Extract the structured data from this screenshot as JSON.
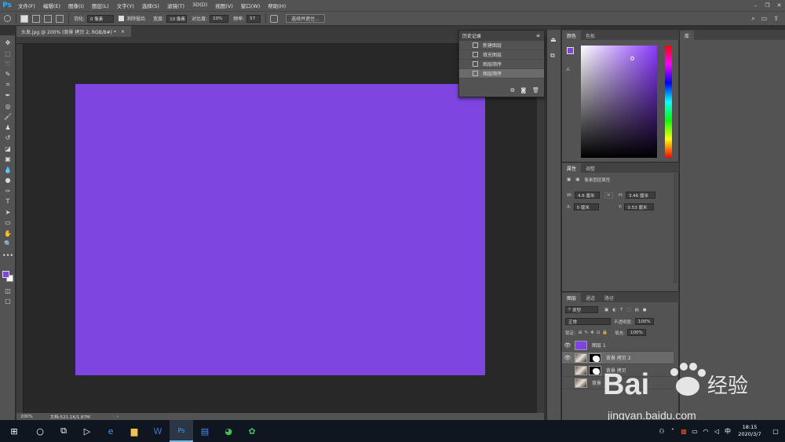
{
  "app": {
    "logo": "Ps"
  },
  "menu": [
    "文件(F)",
    "编辑(E)",
    "图像(I)",
    "图层(L)",
    "文字(Y)",
    "选择(S)",
    "滤镜(T)",
    "3D(D)",
    "视图(V)",
    "窗口(W)",
    "帮助(H)"
  ],
  "window_controls": [
    "–",
    "❐",
    "✕"
  ],
  "options": {
    "feather_label": "羽化:",
    "feather_value": "0 像素",
    "antialias_label": "消除锯齿",
    "width_label": "宽度:",
    "width_value": "10 像素",
    "contrast_label": "对比度:",
    "contrast_value": "10%",
    "frequency_label": "频率:",
    "frequency_value": "57",
    "select_mask_button": "选择并遮住..."
  },
  "document": {
    "tab_title": "头发.jpg @ 200% (背景 拷贝 2, RGB/8#) *",
    "zoom": "200%",
    "doc_info": "文档:521.1K/1.87M",
    "canvas_color": "#7f45e0"
  },
  "history": {
    "title": "历史记录",
    "items": [
      {
        "label": "新建图层",
        "active": false
      },
      {
        "label": "填充图层",
        "active": false
      },
      {
        "label": "图层顺序",
        "active": false
      },
      {
        "label": "图层顺序",
        "active": true
      }
    ]
  },
  "color_panel": {
    "tabs": [
      "颜色",
      "色板"
    ],
    "foreground": "#7f45e0"
  },
  "properties": {
    "tabs": [
      "属性",
      "调整"
    ],
    "subtitle": "像素图层属性",
    "w_label": "W:",
    "w_value": "4.6 厘米",
    "h_label": "H:",
    "h_value": "3.46 厘米",
    "x_label": "X:",
    "x_value": "0 厘米",
    "y_label": "Y:",
    "y_value": "0.53 厘米"
  },
  "layers": {
    "tabs": [
      "图层",
      "通道",
      "路径"
    ],
    "filter_kind": "类型",
    "blend_mode": "正常",
    "opacity_label": "不透明度:",
    "opacity_value": "100%",
    "lock_label": "锁定:",
    "fill_label": "填充:",
    "fill_value": "100%",
    "items": [
      {
        "name": "图层 1",
        "visible": true,
        "active": false
      },
      {
        "name": "背景 拷贝 2",
        "visible": true,
        "active": true
      },
      {
        "name": "背景 拷贝",
        "visible": false,
        "active": false
      },
      {
        "name": "背景",
        "visible": false,
        "active": false
      }
    ]
  },
  "library": {
    "tab": "库"
  },
  "taskbar": {
    "time": "18:15",
    "date": "2020/3/7"
  },
  "watermark": {
    "brand": "Bai",
    "brand2": "经验",
    "url": "jingyan.baidu.com"
  }
}
